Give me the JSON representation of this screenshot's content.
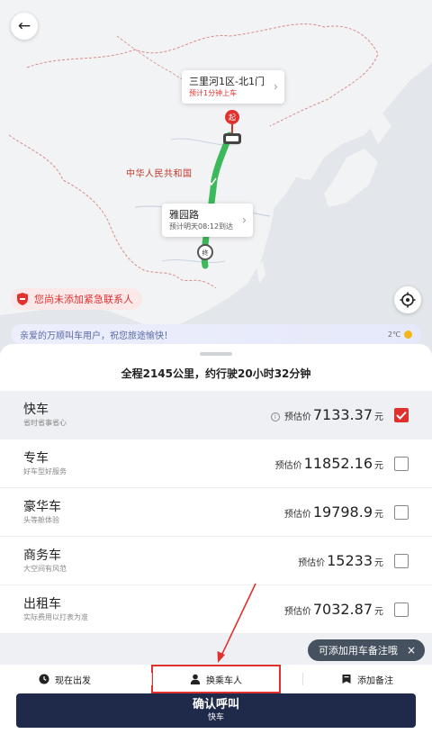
{
  "map": {
    "country_label": "中华人民共和国",
    "start_callout": {
      "title": "三里河1区-北1门",
      "subtitle": "预计1分钟上车"
    },
    "start_marker": "起",
    "end_marker": "终",
    "mid_callout": {
      "title": "雅园路",
      "subtitle": "预计明天08:12到达"
    },
    "emergency_notice": "您尚未添加紧急联系人",
    "banner_text": "亲爱的万顺叫车用户，祝您旅途愉快！",
    "weather": "2℃",
    "colors": {
      "route": "#3cb95a",
      "accent_red": "#e0312f",
      "navy": "#1f2a4a"
    }
  },
  "trip": {
    "summary": "全程2145公里，约行驶20小时32分钟"
  },
  "price_label": "预估价",
  "currency_unit": "元",
  "cars": [
    {
      "name": "快车",
      "desc": "省时省事省心",
      "price": "7133.37",
      "checked": true,
      "info": true
    },
    {
      "name": "专车",
      "desc": "好车型好服务",
      "price": "11852.16",
      "checked": false,
      "info": false
    },
    {
      "name": "豪华车",
      "desc": "头等舱体验",
      "price": "19798.9",
      "checked": false,
      "info": false
    },
    {
      "name": "商务车",
      "desc": "大空间有风范",
      "price": "15233",
      "checked": false,
      "info": false
    },
    {
      "name": "出租车",
      "desc": "实际费用以打表为准",
      "price": "7032.87",
      "checked": false,
      "info": false
    }
  ],
  "tip": {
    "text": "可添加用车备注哦",
    "close": "×"
  },
  "actions": {
    "depart_now": "现在出发",
    "change_passenger": "换乘车人",
    "add_note": "添加备注"
  },
  "confirm": {
    "title": "确认呼叫",
    "subtitle": "快车"
  }
}
